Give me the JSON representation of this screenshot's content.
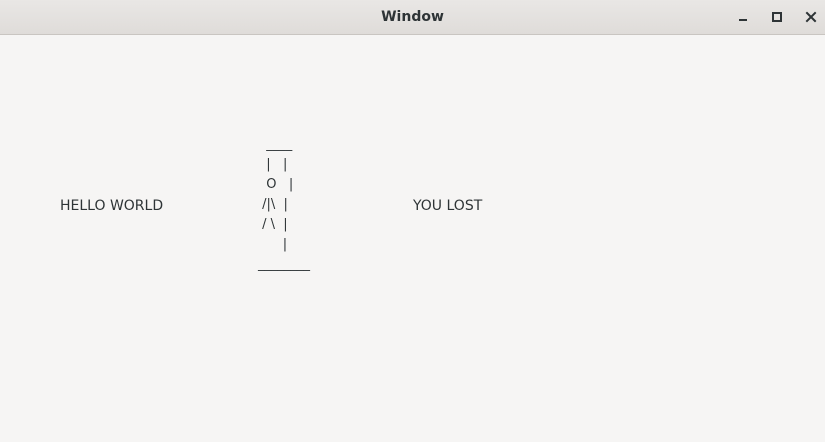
{
  "window": {
    "title": "Window",
    "controls": {
      "minimize_icon": "minimize-icon",
      "maximize_icon": "maximize-icon",
      "close_icon": "close-icon"
    }
  },
  "main": {
    "left_text": "HELLO WORLD",
    "right_text": "YOU LOST",
    "hangman_art": "  ____\n  |   |\n  O   |\n /|\\  |\n / \\  |\n      |\n________"
  }
}
